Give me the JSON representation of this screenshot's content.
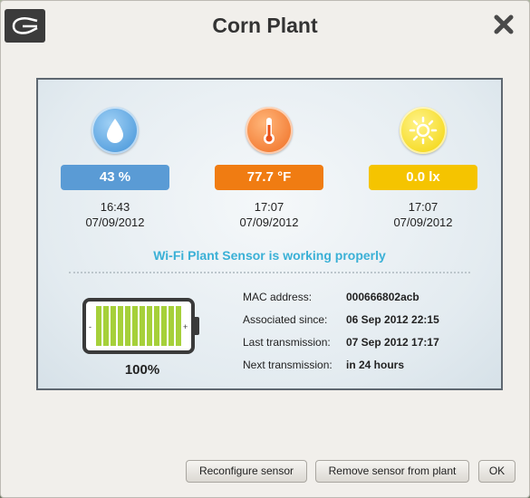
{
  "dialog": {
    "title": "Corn Plant"
  },
  "sensors": [
    {
      "icon": "water-drop-icon",
      "value": "43 %",
      "color": "#5a9bd5",
      "time": "16:43",
      "date": "07/09/2012"
    },
    {
      "icon": "thermometer-icon",
      "value": "77.7 °F",
      "color": "#f07c12",
      "time": "17:07",
      "date": "07/09/2012"
    },
    {
      "icon": "sun-icon",
      "value": "0.0 lx",
      "color": "#f5c400",
      "time": "17:07",
      "date": "07/09/2012"
    }
  ],
  "status_message": "Wi-Fi Plant Sensor is working properly",
  "battery": {
    "percent": "100%",
    "level": 1.0,
    "color": "#a6d03a"
  },
  "info": [
    {
      "label": "MAC address:",
      "value": "000666802acb"
    },
    {
      "label": "Associated since:",
      "value": "06 Sep 2012 22:15"
    },
    {
      "label": "Last transmission:",
      "value": "07 Sep 2012 17:17"
    },
    {
      "label": "Next transmission:",
      "value": "in 24 hours"
    }
  ],
  "buttons": {
    "reconfigure": "Reconfigure sensor",
    "remove": "Remove sensor from plant",
    "ok": "OK"
  }
}
